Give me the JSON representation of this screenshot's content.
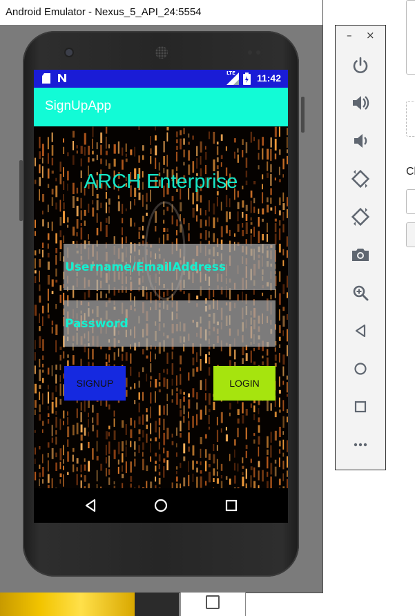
{
  "window": {
    "title": "Android Emulator - Nexus_5_API_24:5554"
  },
  "status_bar": {
    "time": "11:42",
    "network": "LTE",
    "notification_icons": [
      "sd-card-icon",
      "n-notification-icon"
    ],
    "battery_icon": "battery-icon",
    "signal_icon": "signal-icon"
  },
  "app": {
    "title": "SignUpApp",
    "heading": "ARCH Enterprise",
    "username_placeholder": "Username/EmailAddress",
    "password_placeholder": "Password",
    "signup_label": "SIGNUP",
    "login_label": "LOGIN",
    "colors": {
      "status_bar": "#1a1cd6",
      "app_bar": "#12fbd6",
      "heading": "#14e6c6",
      "signup_button": "#1529e0",
      "login_button": "#a6e40e"
    }
  },
  "nav_bar": {
    "buttons": [
      "back-icon",
      "home-icon",
      "recents-icon"
    ]
  },
  "toolbar": {
    "minimize": "–",
    "close": "×",
    "buttons": [
      "power-icon",
      "volume-up-icon",
      "volume-down-icon",
      "rotate-left-icon",
      "rotate-right-icon",
      "camera-icon",
      "zoom-icon",
      "back-icon",
      "home-icon",
      "overview-icon",
      "more-icon"
    ]
  },
  "right_edge": {
    "partial_text": "Cl"
  }
}
